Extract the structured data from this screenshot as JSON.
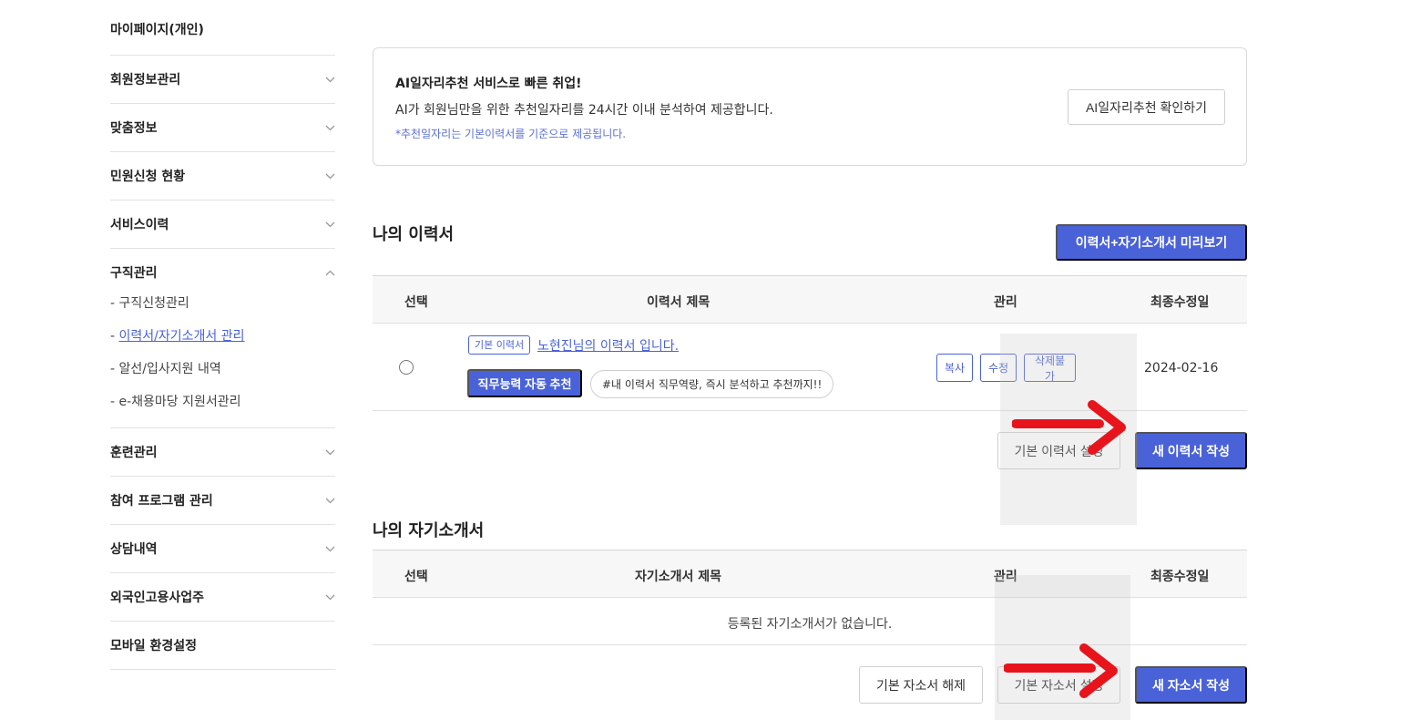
{
  "sidebar": {
    "title": "마이페이지(개인)",
    "items_top": [
      {
        "label": "회원정보관리"
      },
      {
        "label": "맞춤정보"
      },
      {
        "label": "민원신청 현황"
      },
      {
        "label": "서비스이력"
      }
    ],
    "open_group": {
      "label": "구직관리",
      "subitems": [
        {
          "label": "- 구직신청관리"
        },
        {
          "prefix": "- ",
          "label": "이력서/자기소개서 관리"
        },
        {
          "label": "- 알선/입사지원 내역"
        },
        {
          "label": "- e-채용마당 지원서관리"
        }
      ]
    },
    "items_bottom": [
      {
        "label": "훈련관리"
      },
      {
        "label": "참여 프로그램 관리"
      },
      {
        "label": "상담내역"
      },
      {
        "label": "외국인고용사업주"
      },
      {
        "label": "모바일 환경설정"
      }
    ]
  },
  "ai_banner": {
    "title": "AI일자리추천 서비스로 빠른 취업!",
    "desc": "AI가 회원님만을 위한 추천일자리를 24시간 이내 분석하여 제공합니다.",
    "note": "*추천일자리는 기본이력서를 기준으로 제공됩니다.",
    "button": "AI일자리추천 확인하기"
  },
  "resume_section": {
    "title": "나의 이력서",
    "preview_button": "이력서+자기소개서 미리보기",
    "headers": {
      "select": "선택",
      "title": "이력서 제목",
      "manage": "관리",
      "date": "최종수정일"
    },
    "row": {
      "tag": "기본 이력서",
      "title": "노현진님의 이력서 입니다.",
      "skill_button": "직무능력 자동 추천",
      "hashtag": "#내 이력서 직무역량, 즉시 분석하고 추천까지!!",
      "copy": "복사",
      "edit": "수정",
      "delete": "삭제불가",
      "date": "2024-02-16"
    },
    "set_default_button": "기본 이력서 설정",
    "new_button": "새 이력서 작성"
  },
  "cover_section": {
    "title": "나의 자기소개서",
    "headers": {
      "select": "선택",
      "title": "자기소개서 제목",
      "manage": "관리",
      "date": "최종수정일"
    },
    "empty": "등록된 자기소개서가 없습니다.",
    "unset_default_button": "기본 자소서 해제",
    "set_default_button": "기본 자소서 설정",
    "new_button": "새 자소서 작성"
  },
  "colors": {
    "accent": "#4a62d8",
    "arrow": "#e8141c"
  }
}
